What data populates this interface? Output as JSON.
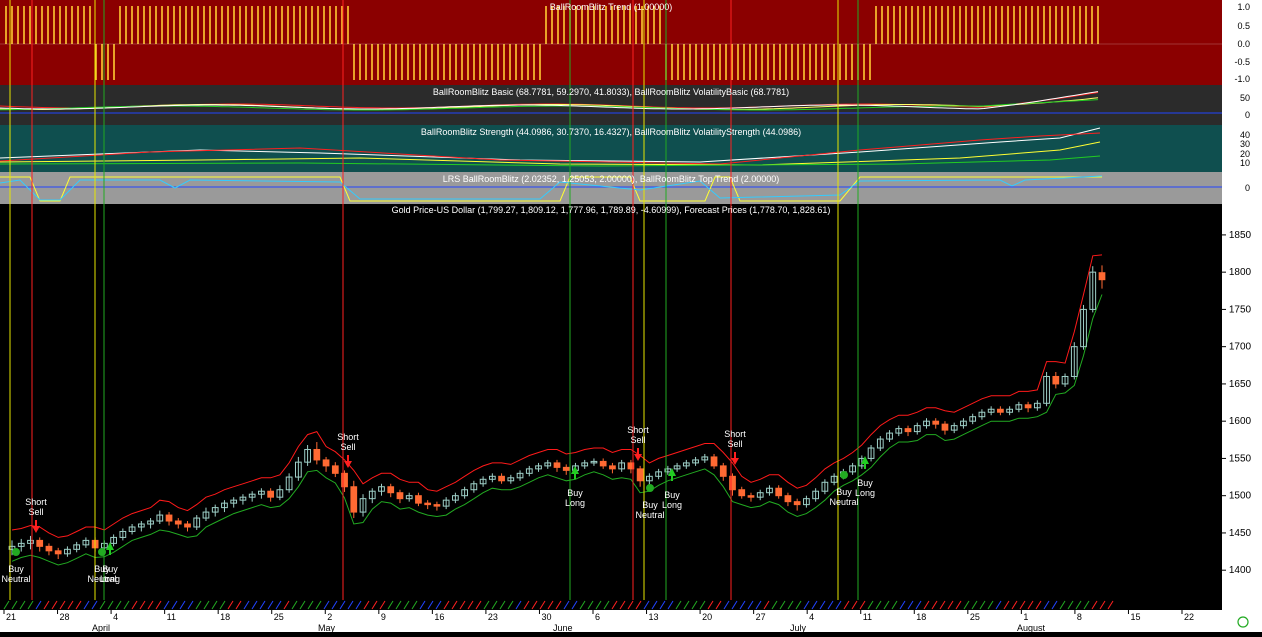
{
  "colors": {
    "background": "#000000",
    "trend_panel": "#8b0000",
    "basic_panel": "#2b2b2b",
    "strength_panel": "#0f4f4f",
    "lrs_panel": "#9a9a9a",
    "axis_bg": "#ffffff",
    "bull_candle": "#9fd0c8",
    "bear_candle": "#ff6a33",
    "upper_band": "#ff1a1a",
    "lower_band": "#22aa22",
    "buy_line": "#22aa22",
    "sell_line": "#ff2020",
    "neutral_line": "#e6e600",
    "trend_bar": "#ffcc33"
  },
  "panels": {
    "trend": {
      "title": "BallRoomBlitz Trend (1.00000)",
      "ticks": [
        "1.0",
        "0.5",
        "0.0",
        "-0.5",
        "-1.0"
      ]
    },
    "basic": {
      "title": "BallRoomBlitz Basic (68.7781, 59.2970, 41.8033), BallRoomBlitz VolatilityBasic (68.7781)",
      "ticks": [
        "50",
        "0"
      ]
    },
    "strength": {
      "title": "BallRoomBlitz Strength (44.0986, 30.7370, 16.4327), BallRoomBlitz VolatilityStrength (44.0986)",
      "ticks": [
        "40",
        "30",
        "20",
        "10"
      ]
    },
    "lrs": {
      "title": "LRS BallRoomBlitz (2.02352, 1.25053, 2.00000), BallRoomBlitz Top Trend (2.00000)",
      "ticks": [
        "0"
      ]
    },
    "price": {
      "title": "Gold Price-US Dollar (1,799.27, 1,809.12, 1,777.96, 1,789.89, -4.60999), Forecast Prices (1,778.70, 1,828.61)",
      "ticks": [
        "1850",
        "1800",
        "1750",
        "1700",
        "1650",
        "1600",
        "1550",
        "1500",
        "1450",
        "1400"
      ]
    }
  },
  "signals": [
    {
      "lines": [
        "Short",
        "Sell"
      ],
      "kind": "sell"
    },
    {
      "lines": [
        "Buy",
        "Neutral"
      ],
      "kind": "neutral"
    },
    {
      "lines": [
        "Buy",
        "Neutral"
      ],
      "kind": "neutral"
    },
    {
      "lines": [
        "Buy",
        "Long"
      ],
      "kind": "buy"
    },
    {
      "lines": [
        "Short",
        "Sell"
      ],
      "kind": "sell"
    },
    {
      "lines": [
        "Buy",
        "Long"
      ],
      "kind": "buy"
    },
    {
      "lines": [
        "Short",
        "Sell"
      ],
      "kind": "sell"
    },
    {
      "lines": [
        "Buy",
        "Neutral"
      ],
      "kind": "neutral"
    },
    {
      "lines": [
        "Buy",
        "Long"
      ],
      "kind": "buy"
    },
    {
      "lines": [
        "Short",
        "Sell"
      ],
      "kind": "sell"
    },
    {
      "lines": [
        "Buy",
        "Neutral"
      ],
      "kind": "neutral"
    },
    {
      "lines": [
        "Buy",
        "Long"
      ],
      "kind": "buy"
    }
  ],
  "chart_data": {
    "type": "candlestick",
    "title": "Gold Price-US Dollar (1,799.27, 1,809.12, 1,777.96, 1,789.89, -4.60999), Forecast Prices (1,778.70, 1,828.61)",
    "ylim": [
      1360,
      1870
    ],
    "x_ticks": [
      "21",
      "28",
      "4",
      "11",
      "18",
      "25",
      "2",
      "9",
      "16",
      "23",
      "30",
      "6",
      "13",
      "20",
      "27",
      "4",
      "11",
      "18",
      "25",
      "1",
      "8",
      "15",
      "22"
    ],
    "month_labels": [
      "April",
      "May",
      "June",
      "July",
      "August"
    ],
    "candles": [
      {
        "o": 1428,
        "c": 1432,
        "h": 1440,
        "l": 1420
      },
      {
        "o": 1432,
        "c": 1436,
        "h": 1442,
        "l": 1425
      },
      {
        "o": 1436,
        "c": 1440,
        "h": 1446,
        "l": 1428
      },
      {
        "o": 1440,
        "c": 1432,
        "h": 1444,
        "l": 1425
      },
      {
        "o": 1432,
        "c": 1426,
        "h": 1436,
        "l": 1420
      },
      {
        "o": 1426,
        "c": 1422,
        "h": 1430,
        "l": 1415
      },
      {
        "o": 1422,
        "c": 1428,
        "h": 1432,
        "l": 1418
      },
      {
        "o": 1428,
        "c": 1434,
        "h": 1438,
        "l": 1424
      },
      {
        "o": 1434,
        "c": 1440,
        "h": 1444,
        "l": 1430
      },
      {
        "o": 1440,
        "c": 1430,
        "h": 1444,
        "l": 1425
      },
      {
        "o": 1430,
        "c": 1436,
        "h": 1440,
        "l": 1426
      },
      {
        "o": 1436,
        "c": 1444,
        "h": 1448,
        "l": 1432
      },
      {
        "o": 1444,
        "c": 1452,
        "h": 1456,
        "l": 1440
      },
      {
        "o": 1452,
        "c": 1458,
        "h": 1462,
        "l": 1448
      },
      {
        "o": 1458,
        "c": 1462,
        "h": 1466,
        "l": 1452
      },
      {
        "o": 1462,
        "c": 1466,
        "h": 1470,
        "l": 1456
      },
      {
        "o": 1466,
        "c": 1474,
        "h": 1480,
        "l": 1462
      },
      {
        "o": 1474,
        "c": 1466,
        "h": 1478,
        "l": 1460
      },
      {
        "o": 1466,
        "c": 1462,
        "h": 1470,
        "l": 1456
      },
      {
        "o": 1462,
        "c": 1458,
        "h": 1466,
        "l": 1452
      },
      {
        "o": 1458,
        "c": 1470,
        "h": 1474,
        "l": 1454
      },
      {
        "o": 1470,
        "c": 1478,
        "h": 1484,
        "l": 1466
      },
      {
        "o": 1478,
        "c": 1484,
        "h": 1488,
        "l": 1472
      },
      {
        "o": 1484,
        "c": 1490,
        "h": 1494,
        "l": 1478
      },
      {
        "o": 1490,
        "c": 1494,
        "h": 1498,
        "l": 1484
      },
      {
        "o": 1494,
        "c": 1498,
        "h": 1502,
        "l": 1488
      },
      {
        "o": 1498,
        "c": 1502,
        "h": 1506,
        "l": 1492
      },
      {
        "o": 1502,
        "c": 1506,
        "h": 1510,
        "l": 1496
      },
      {
        "o": 1506,
        "c": 1498,
        "h": 1510,
        "l": 1492
      },
      {
        "o": 1498,
        "c": 1508,
        "h": 1514,
        "l": 1494
      },
      {
        "o": 1508,
        "c": 1525,
        "h": 1530,
        "l": 1504
      },
      {
        "o": 1525,
        "c": 1545,
        "h": 1552,
        "l": 1520
      },
      {
        "o": 1545,
        "c": 1562,
        "h": 1568,
        "l": 1540
      },
      {
        "o": 1562,
        "c": 1548,
        "h": 1572,
        "l": 1542
      },
      {
        "o": 1548,
        "c": 1540,
        "h": 1552,
        "l": 1532
      },
      {
        "o": 1540,
        "c": 1530,
        "h": 1545,
        "l": 1525
      },
      {
        "o": 1530,
        "c": 1512,
        "h": 1534,
        "l": 1505
      },
      {
        "o": 1512,
        "c": 1478,
        "h": 1520,
        "l": 1470
      },
      {
        "o": 1478,
        "c": 1496,
        "h": 1502,
        "l": 1472
      },
      {
        "o": 1496,
        "c": 1506,
        "h": 1510,
        "l": 1490
      },
      {
        "o": 1506,
        "c": 1512,
        "h": 1516,
        "l": 1500
      },
      {
        "o": 1512,
        "c": 1504,
        "h": 1516,
        "l": 1498
      },
      {
        "o": 1504,
        "c": 1496,
        "h": 1508,
        "l": 1490
      },
      {
        "o": 1496,
        "c": 1500,
        "h": 1504,
        "l": 1492
      },
      {
        "o": 1500,
        "c": 1490,
        "h": 1504,
        "l": 1486
      },
      {
        "o": 1490,
        "c": 1488,
        "h": 1494,
        "l": 1482
      },
      {
        "o": 1488,
        "c": 1486,
        "h": 1492,
        "l": 1480
      },
      {
        "o": 1486,
        "c": 1494,
        "h": 1498,
        "l": 1482
      },
      {
        "o": 1494,
        "c": 1500,
        "h": 1504,
        "l": 1490
      },
      {
        "o": 1500,
        "c": 1508,
        "h": 1512,
        "l": 1496
      },
      {
        "o": 1508,
        "c": 1516,
        "h": 1520,
        "l": 1504
      },
      {
        "o": 1516,
        "c": 1522,
        "h": 1526,
        "l": 1512
      },
      {
        "o": 1522,
        "c": 1526,
        "h": 1530,
        "l": 1518
      },
      {
        "o": 1526,
        "c": 1520,
        "h": 1530,
        "l": 1516
      },
      {
        "o": 1520,
        "c": 1524,
        "h": 1528,
        "l": 1516
      },
      {
        "o": 1524,
        "c": 1530,
        "h": 1534,
        "l": 1520
      },
      {
        "o": 1530,
        "c": 1536,
        "h": 1540,
        "l": 1526
      },
      {
        "o": 1536,
        "c": 1540,
        "h": 1544,
        "l": 1532
      },
      {
        "o": 1540,
        "c": 1544,
        "h": 1548,
        "l": 1536
      },
      {
        "o": 1544,
        "c": 1538,
        "h": 1548,
        "l": 1532
      },
      {
        "o": 1538,
        "c": 1534,
        "h": 1542,
        "l": 1528
      },
      {
        "o": 1534,
        "c": 1540,
        "h": 1544,
        "l": 1530
      },
      {
        "o": 1540,
        "c": 1544,
        "h": 1548,
        "l": 1536
      },
      {
        "o": 1544,
        "c": 1546,
        "h": 1550,
        "l": 1540
      },
      {
        "o": 1546,
        "c": 1540,
        "h": 1550,
        "l": 1536
      },
      {
        "o": 1540,
        "c": 1536,
        "h": 1544,
        "l": 1530
      },
      {
        "o": 1536,
        "c": 1544,
        "h": 1548,
        "l": 1532
      },
      {
        "o": 1544,
        "c": 1536,
        "h": 1548,
        "l": 1530
      },
      {
        "o": 1536,
        "c": 1520,
        "h": 1540,
        "l": 1512
      },
      {
        "o": 1520,
        "c": 1526,
        "h": 1530,
        "l": 1514
      },
      {
        "o": 1526,
        "c": 1532,
        "h": 1536,
        "l": 1522
      },
      {
        "o": 1532,
        "c": 1536,
        "h": 1540,
        "l": 1528
      },
      {
        "o": 1536,
        "c": 1540,
        "h": 1544,
        "l": 1532
      },
      {
        "o": 1540,
        "c": 1544,
        "h": 1548,
        "l": 1536
      },
      {
        "o": 1544,
        "c": 1548,
        "h": 1552,
        "l": 1540
      },
      {
        "o": 1548,
        "c": 1552,
        "h": 1556,
        "l": 1544
      },
      {
        "o": 1552,
        "c": 1540,
        "h": 1556,
        "l": 1536
      },
      {
        "o": 1540,
        "c": 1526,
        "h": 1544,
        "l": 1520
      },
      {
        "o": 1526,
        "c": 1508,
        "h": 1530,
        "l": 1500
      },
      {
        "o": 1508,
        "c": 1500,
        "h": 1512,
        "l": 1496
      },
      {
        "o": 1500,
        "c": 1498,
        "h": 1504,
        "l": 1492
      },
      {
        "o": 1498,
        "c": 1504,
        "h": 1508,
        "l": 1494
      },
      {
        "o": 1504,
        "c": 1510,
        "h": 1514,
        "l": 1500
      },
      {
        "o": 1510,
        "c": 1500,
        "h": 1514,
        "l": 1496
      },
      {
        "o": 1500,
        "c": 1492,
        "h": 1504,
        "l": 1486
      },
      {
        "o": 1492,
        "c": 1488,
        "h": 1496,
        "l": 1480
      },
      {
        "o": 1488,
        "c": 1496,
        "h": 1500,
        "l": 1484
      },
      {
        "o": 1496,
        "c": 1506,
        "h": 1510,
        "l": 1492
      },
      {
        "o": 1506,
        "c": 1518,
        "h": 1522,
        "l": 1502
      },
      {
        "o": 1518,
        "c": 1526,
        "h": 1530,
        "l": 1514
      },
      {
        "o": 1526,
        "c": 1532,
        "h": 1536,
        "l": 1522
      },
      {
        "o": 1532,
        "c": 1540,
        "h": 1544,
        "l": 1528
      },
      {
        "o": 1540,
        "c": 1550,
        "h": 1554,
        "l": 1536
      },
      {
        "o": 1550,
        "c": 1564,
        "h": 1568,
        "l": 1546
      },
      {
        "o": 1564,
        "c": 1576,
        "h": 1580,
        "l": 1560
      },
      {
        "o": 1576,
        "c": 1584,
        "h": 1588,
        "l": 1572
      },
      {
        "o": 1584,
        "c": 1590,
        "h": 1594,
        "l": 1580
      },
      {
        "o": 1590,
        "c": 1586,
        "h": 1594,
        "l": 1580
      },
      {
        "o": 1586,
        "c": 1594,
        "h": 1598,
        "l": 1582
      },
      {
        "o": 1594,
        "c": 1600,
        "h": 1604,
        "l": 1590
      },
      {
        "o": 1600,
        "c": 1596,
        "h": 1604,
        "l": 1590
      },
      {
        "o": 1596,
        "c": 1588,
        "h": 1600,
        "l": 1582
      },
      {
        "o": 1588,
        "c": 1594,
        "h": 1598,
        "l": 1584
      },
      {
        "o": 1594,
        "c": 1600,
        "h": 1604,
        "l": 1590
      },
      {
        "o": 1600,
        "c": 1606,
        "h": 1610,
        "l": 1596
      },
      {
        "o": 1606,
        "c": 1612,
        "h": 1616,
        "l": 1602
      },
      {
        "o": 1612,
        "c": 1616,
        "h": 1620,
        "l": 1608
      },
      {
        "o": 1616,
        "c": 1612,
        "h": 1620,
        "l": 1608
      },
      {
        "o": 1612,
        "c": 1616,
        "h": 1620,
        "l": 1608
      },
      {
        "o": 1616,
        "c": 1622,
        "h": 1626,
        "l": 1612
      },
      {
        "o": 1622,
        "c": 1618,
        "h": 1626,
        "l": 1612
      },
      {
        "o": 1618,
        "c": 1624,
        "h": 1628,
        "l": 1614
      },
      {
        "o": 1624,
        "c": 1660,
        "h": 1666,
        "l": 1620
      },
      {
        "o": 1660,
        "c": 1650,
        "h": 1666,
        "l": 1644
      },
      {
        "o": 1650,
        "c": 1660,
        "h": 1664,
        "l": 1646
      },
      {
        "o": 1660,
        "c": 1700,
        "h": 1706,
        "l": 1656
      },
      {
        "o": 1700,
        "c": 1750,
        "h": 1756,
        "l": 1696
      },
      {
        "o": 1750,
        "c": 1800,
        "h": 1808,
        "l": 1746
      },
      {
        "o": 1799.27,
        "c": 1789.89,
        "h": 1809.12,
        "l": 1777.96
      }
    ]
  }
}
